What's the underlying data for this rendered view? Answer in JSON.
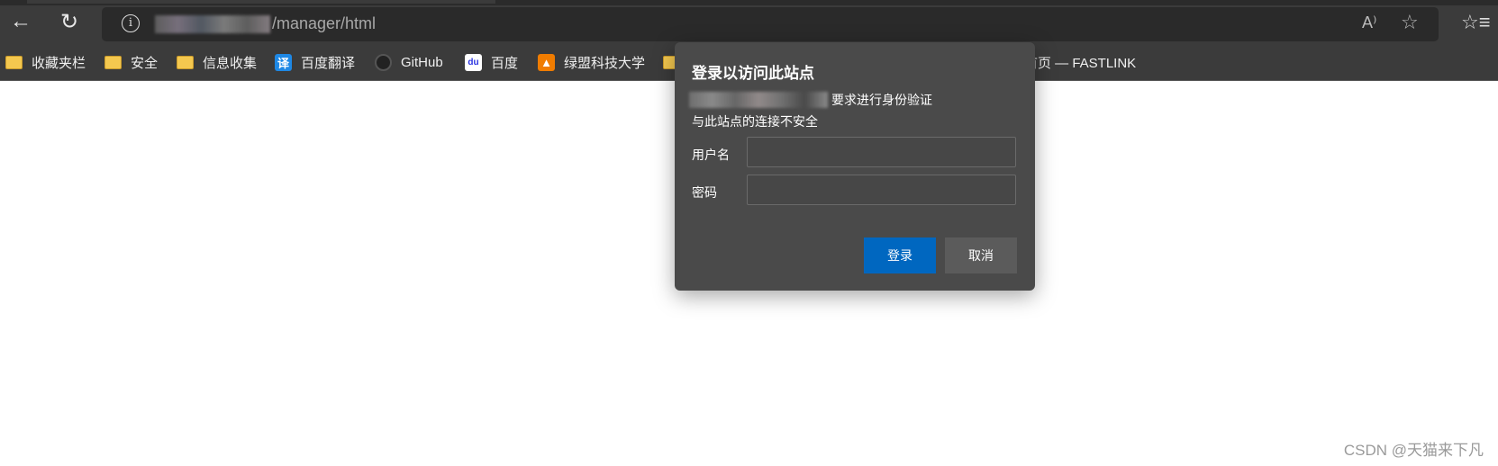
{
  "browser": {
    "url_path": "/manager/html",
    "icons": {
      "back": "arrow-left-icon",
      "refresh": "refresh-icon",
      "info": "info-icon",
      "read_aloud": "read-aloud-icon",
      "add_favorite": "star-plus-icon",
      "favorites": "favorites-icon"
    },
    "read_aloud_glyph": "A⁾"
  },
  "bookmarks": [
    {
      "label": "收藏夹栏",
      "icon": "folder-icon"
    },
    {
      "label": "安全",
      "icon": "folder-icon"
    },
    {
      "label": "信息收集",
      "icon": "folder-icon"
    },
    {
      "label": "百度翻译",
      "icon": "baidu-translate-icon",
      "glyph": "译"
    },
    {
      "label": "GitHub",
      "icon": "github-icon"
    },
    {
      "label": "百度",
      "icon": "baidu-icon",
      "glyph": "du"
    },
    {
      "label": "绿盟科技大学",
      "icon": "nsfocus-icon"
    },
    {
      "label": "首页 — FASTLINK",
      "icon": "folder-icon"
    }
  ],
  "dialog": {
    "title": "登录以访问此站点",
    "requires_auth": "要求进行身份验证",
    "insecure": "与此站点的连接不安全",
    "username_label": "用户名",
    "username_value": "",
    "password_label": "密码",
    "password_value": "",
    "login_label": "登录",
    "cancel_label": "取消",
    "accent": "#0067c0"
  },
  "watermark": "CSDN @天猫来下凡"
}
